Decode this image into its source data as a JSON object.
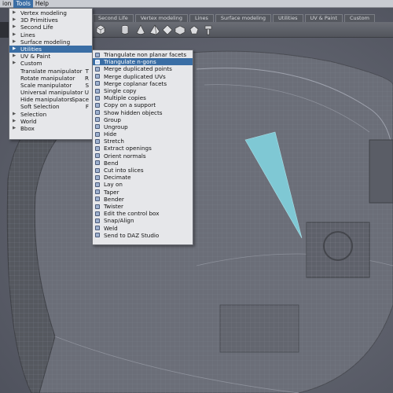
{
  "menubar": {
    "items": [
      {
        "label": "ion",
        "active": false
      },
      {
        "label": "Tools",
        "active": true
      },
      {
        "label": "Help",
        "active": false
      }
    ]
  },
  "tabs": [
    "Second Life",
    "Vertex modeling",
    "Lines",
    "Surface modeling",
    "Utilities",
    "UV & Paint",
    "Custom"
  ],
  "toolbar": {
    "icons": [
      "cube-icon",
      "cylinder-icon",
      "cone-icon",
      "pyramid-icon",
      "diamond-icon",
      "box-icon",
      "sphere-icon",
      "wrench-icon"
    ]
  },
  "tools_menu": {
    "items": [
      {
        "label": "Vertex modeling",
        "submenu": true,
        "shortcut": ""
      },
      {
        "label": "3D Primitives",
        "submenu": true,
        "shortcut": ""
      },
      {
        "label": "Second Life",
        "submenu": true,
        "shortcut": ""
      },
      {
        "label": "Lines",
        "submenu": true,
        "shortcut": ""
      },
      {
        "label": "Surface modeling",
        "submenu": true,
        "shortcut": ""
      },
      {
        "label": "Utilities",
        "submenu": true,
        "shortcut": "",
        "highlighted": true
      },
      {
        "label": "UV & Paint",
        "submenu": true,
        "shortcut": ""
      },
      {
        "label": "Custom",
        "submenu": true,
        "shortcut": ""
      },
      {
        "label": "Translate manipulator",
        "submenu": false,
        "shortcut": "T"
      },
      {
        "label": "Rotate manipulator",
        "submenu": false,
        "shortcut": "R"
      },
      {
        "label": "Scale manipulator",
        "submenu": false,
        "shortcut": "S"
      },
      {
        "label": "Universal manipulator",
        "submenu": false,
        "shortcut": "U"
      },
      {
        "label": "Hide manipulators",
        "submenu": false,
        "shortcut": "Space"
      },
      {
        "label": "Soft Selection",
        "submenu": false,
        "shortcut": "F"
      },
      {
        "label": "Selection",
        "submenu": true,
        "shortcut": ""
      },
      {
        "label": "World",
        "submenu": true,
        "shortcut": ""
      },
      {
        "label": "Bbox",
        "submenu": true,
        "shortcut": ""
      }
    ]
  },
  "utilities_menu": {
    "items": [
      {
        "label": "Triangulate non planar facets"
      },
      {
        "label": "Triangulate n-gons",
        "highlighted": true
      },
      {
        "label": "Merge duplicated points"
      },
      {
        "label": "Merge duplicated UVs"
      },
      {
        "label": "Merge coplanar facets"
      },
      {
        "label": "Single copy"
      },
      {
        "label": "Multiple copies"
      },
      {
        "label": "Copy on a support"
      },
      {
        "label": "Show hidden objects"
      },
      {
        "label": "Group"
      },
      {
        "label": "Ungroup"
      },
      {
        "label": "Hide"
      },
      {
        "label": "Stretch"
      },
      {
        "label": "Extract openings"
      },
      {
        "label": "Orient normals"
      },
      {
        "label": "Bend"
      },
      {
        "label": "Cut into slices"
      },
      {
        "label": "Decimate"
      },
      {
        "label": "Lay on"
      },
      {
        "label": "Taper"
      },
      {
        "label": "Bender"
      },
      {
        "label": "Twister"
      },
      {
        "label": "Edit the control box"
      },
      {
        "label": "Snap/Align"
      },
      {
        "label": "Weld"
      },
      {
        "label": "Send to DAZ Studio"
      }
    ]
  },
  "colors": {
    "highlight": "#3a6ea5",
    "selected_facet": "#7fc8d4",
    "viewport_bg": "#5d606b"
  }
}
